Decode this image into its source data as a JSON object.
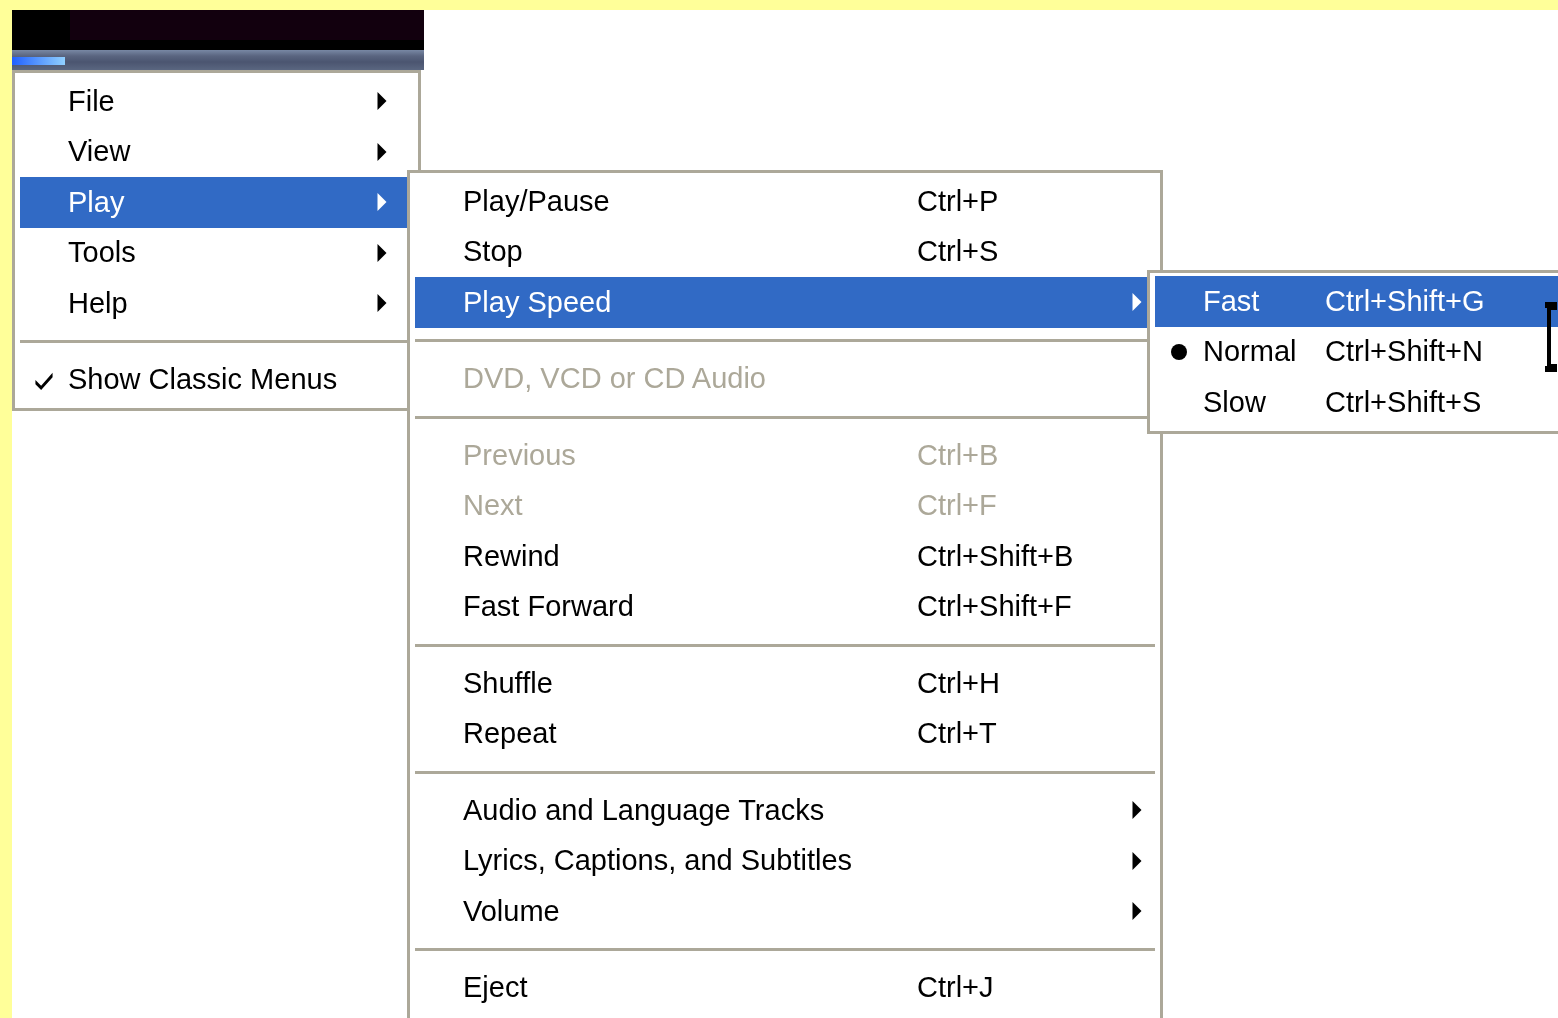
{
  "menus": [
    {
      "items": [
        {
          "kind": "item",
          "label": "File",
          "has_submenu": true,
          "selected": false,
          "disabled": false,
          "checked": false
        },
        {
          "kind": "item",
          "label": "View",
          "has_submenu": true,
          "selected": false,
          "disabled": false,
          "checked": false
        },
        {
          "kind": "item",
          "label": "Play",
          "has_submenu": true,
          "selected": true,
          "disabled": false,
          "checked": false
        },
        {
          "kind": "item",
          "label": "Tools",
          "has_submenu": true,
          "selected": false,
          "disabled": false,
          "checked": false
        },
        {
          "kind": "item",
          "label": "Help",
          "has_submenu": true,
          "selected": false,
          "disabled": false,
          "checked": false
        },
        {
          "kind": "separator"
        },
        {
          "kind": "item",
          "label": "Show Classic Menus",
          "has_submenu": false,
          "selected": false,
          "disabled": false,
          "checked": true
        }
      ]
    },
    {
      "items": [
        {
          "kind": "item",
          "label": "Play/Pause",
          "shortcut": "Ctrl+P",
          "has_submenu": false,
          "selected": false,
          "disabled": false
        },
        {
          "kind": "item",
          "label": "Stop",
          "shortcut": "Ctrl+S",
          "has_submenu": false,
          "selected": false,
          "disabled": false
        },
        {
          "kind": "item",
          "label": "Play Speed",
          "has_submenu": true,
          "selected": true,
          "disabled": false
        },
        {
          "kind": "separator"
        },
        {
          "kind": "item",
          "label": "DVD, VCD or CD Audio",
          "has_submenu": false,
          "selected": false,
          "disabled": true
        },
        {
          "kind": "separator"
        },
        {
          "kind": "item",
          "label": "Previous",
          "shortcut": "Ctrl+B",
          "has_submenu": false,
          "selected": false,
          "disabled": true
        },
        {
          "kind": "item",
          "label": "Next",
          "shortcut": "Ctrl+F",
          "has_submenu": false,
          "selected": false,
          "disabled": true
        },
        {
          "kind": "item",
          "label": "Rewind",
          "shortcut": "Ctrl+Shift+B",
          "has_submenu": false,
          "selected": false,
          "disabled": false
        },
        {
          "kind": "item",
          "label": "Fast Forward",
          "shortcut": "Ctrl+Shift+F",
          "has_submenu": false,
          "selected": false,
          "disabled": false
        },
        {
          "kind": "separator"
        },
        {
          "kind": "item",
          "label": "Shuffle",
          "shortcut": "Ctrl+H",
          "has_submenu": false,
          "selected": false,
          "disabled": false
        },
        {
          "kind": "item",
          "label": "Repeat",
          "shortcut": "Ctrl+T",
          "has_submenu": false,
          "selected": false,
          "disabled": false
        },
        {
          "kind": "separator"
        },
        {
          "kind": "item",
          "label": "Audio and Language Tracks",
          "has_submenu": true,
          "selected": false,
          "disabled": false
        },
        {
          "kind": "item",
          "label": "Lyrics, Captions, and Subtitles",
          "has_submenu": true,
          "selected": false,
          "disabled": false
        },
        {
          "kind": "item",
          "label": "Volume",
          "has_submenu": true,
          "selected": false,
          "disabled": false
        },
        {
          "kind": "separator"
        },
        {
          "kind": "item",
          "label": "Eject",
          "shortcut": "Ctrl+J",
          "has_submenu": false,
          "selected": false,
          "disabled": false
        }
      ]
    },
    {
      "items": [
        {
          "kind": "item",
          "label": "Fast",
          "shortcut": "Ctrl+Shift+G",
          "has_submenu": false,
          "selected": true,
          "disabled": false,
          "radio": false
        },
        {
          "kind": "item",
          "label": "Normal",
          "shortcut": "Ctrl+Shift+N",
          "has_submenu": false,
          "selected": false,
          "disabled": false,
          "radio": true
        },
        {
          "kind": "item",
          "label": "Slow",
          "shortcut": "Ctrl+Shift+S",
          "has_submenu": false,
          "selected": false,
          "disabled": false,
          "radio": false
        }
      ]
    }
  ]
}
